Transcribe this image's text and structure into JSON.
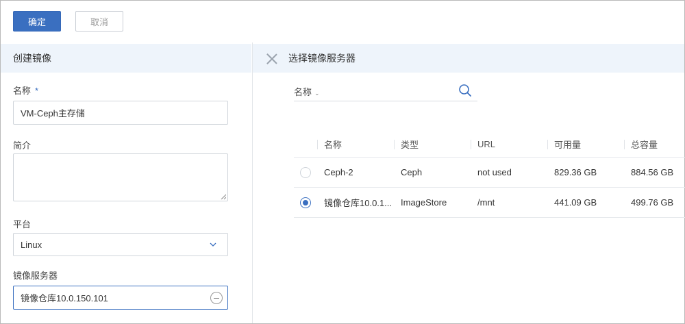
{
  "toolbar": {
    "confirm_label": "确定",
    "cancel_label": "取消"
  },
  "form": {
    "header": "创建镜像",
    "name_label": "名称",
    "required_mark": "*",
    "name_value": "VM-Ceph主存储",
    "desc_label": "简介",
    "desc_value": "",
    "platform_label": "平台",
    "platform_value": "Linux",
    "server_label": "镜像服务器",
    "server_value": "镜像仓库10.0.150.101"
  },
  "selector": {
    "title": "选择镜像服务器",
    "search_filter": "名称",
    "columns": [
      "名称",
      "类型",
      "URL",
      "可用量",
      "总容量"
    ],
    "rows": [
      {
        "name": "Ceph-2",
        "type": "Ceph",
        "url": "not used",
        "available": "829.36 GB",
        "total": "884.56 GB",
        "selected": false
      },
      {
        "name": "镜像仓库10.0.1...",
        "type": "ImageStore",
        "url": "/mnt",
        "available": "441.09 GB",
        "total": "499.76 GB",
        "selected": true
      }
    ]
  },
  "colors": {
    "accent": "#3a6fc0",
    "header_bg": "#eef4fb"
  },
  "icons": {
    "close": "close-icon",
    "search": "search-icon",
    "dropdown": "chevron-down-icon",
    "remove": "minus-circle-icon"
  }
}
